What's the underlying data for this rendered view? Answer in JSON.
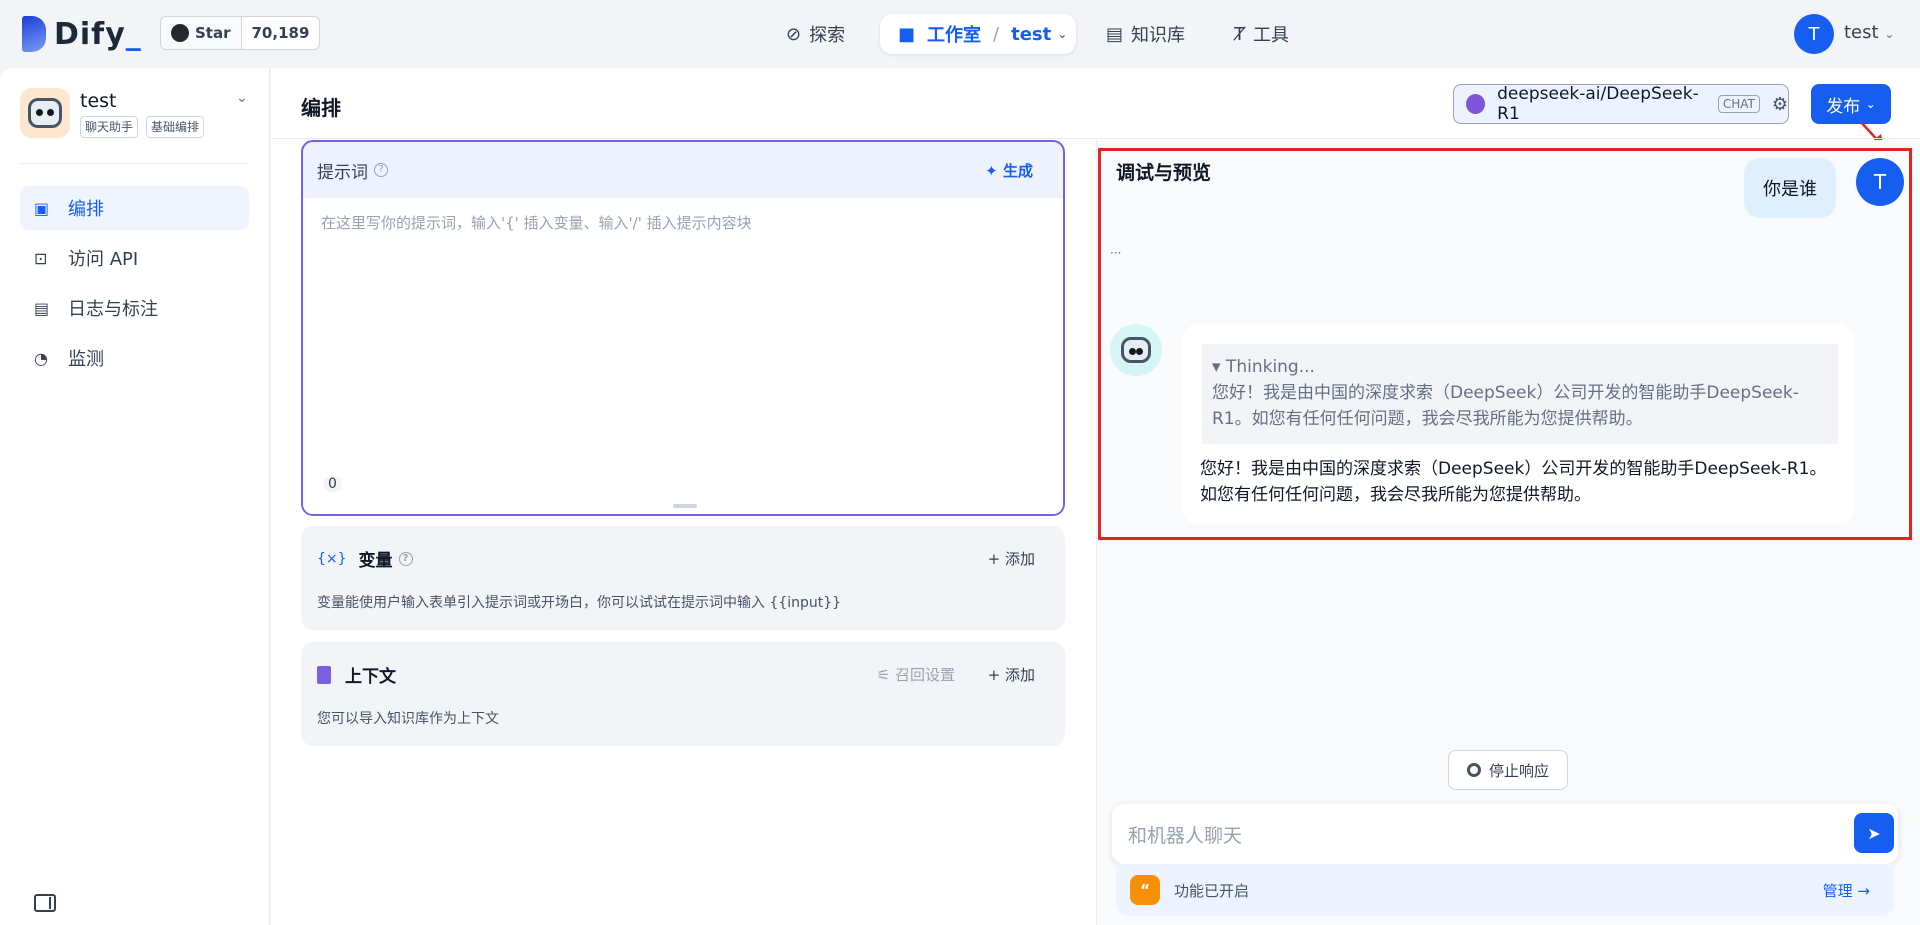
{
  "brand": {
    "name": "Dify",
    "suffix": "_"
  },
  "github": {
    "star_label": "Star",
    "count": "70,189"
  },
  "nav": {
    "explore": "探索",
    "studio": "工作室",
    "app": "test",
    "knowledge": "知识库",
    "tools": "工具"
  },
  "user": {
    "avatar": "T",
    "name": "test"
  },
  "app": {
    "name": "test",
    "tags": [
      "聊天助手",
      "基础编排"
    ]
  },
  "sidebar": {
    "items": [
      {
        "label": "编排"
      },
      {
        "label": "访问 API"
      },
      {
        "label": "日志与标注"
      },
      {
        "label": "监测"
      }
    ]
  },
  "header": {
    "title": "编排",
    "model": "deepseek-ai/DeepSeek-R1",
    "model_tag": "CHAT",
    "publish": "发布"
  },
  "prompt": {
    "title": "提示词",
    "generate": "生成",
    "placeholder": "在这里写你的提示词，输入'{' 插入变量、输入'/' 插入提示内容块",
    "count": "0"
  },
  "variables": {
    "title": "变量",
    "add": "添加",
    "desc": "变量能使用户输入表单引入提示词或开场白，你可以试试在提示词中输入 {{input}}"
  },
  "context": {
    "title": "上下文",
    "recall": "召回设置",
    "add": "添加",
    "desc": "您可以导入知识库作为上下文"
  },
  "debug": {
    "title": "调试与预览",
    "user_message": "你是谁",
    "thinking_label": "▾ Thinking...",
    "thinking_text": "您好！我是由中国的深度求索（DeepSeek）公司开发的智能助手DeepSeek-R1。如您有任何任何问题，我会尽我所能为您提供帮助。",
    "answer": "您好！我是由中国的深度求索（DeepSeek）公司开发的智能助手DeepSeek-R1。如您有任何任何问题，我会尽我所能为您提供帮助。",
    "stop": "停止响应",
    "input_placeholder": "和机器人聊天",
    "features": "功能已开启",
    "manage": "管理 →"
  },
  "colors": {
    "accent": "#155eef",
    "highlight_border": "#e02424"
  }
}
